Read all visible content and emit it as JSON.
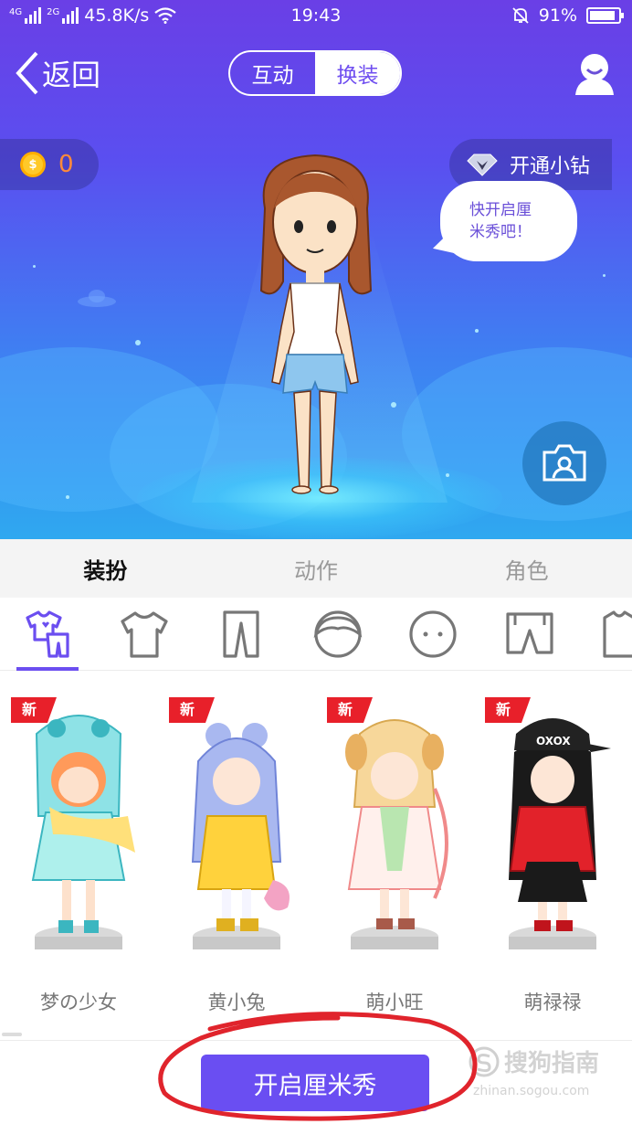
{
  "status_bar": {
    "sig1_tag": "4G",
    "sig2_tag": "2G",
    "speed": "45.8K/s",
    "time": "19:43",
    "battery": "91%",
    "battery_level": 0.91
  },
  "nav": {
    "back_label": "返回",
    "seg_interact": "互动",
    "seg_dressup": "换装"
  },
  "wallet": {
    "coins": "0"
  },
  "vip": {
    "label": "开通小钻"
  },
  "bubble": {
    "line1": "快开启厘",
    "line2": "米秀吧！"
  },
  "tabs": [
    {
      "label": "装扮",
      "active": true
    },
    {
      "label": "动作",
      "active": false
    },
    {
      "label": "角色",
      "active": false
    }
  ],
  "categories": [
    "outfit-set-icon",
    "top-icon",
    "pants-icon",
    "hair-icon",
    "face-icon",
    "shorts-icon",
    "accessory-icon"
  ],
  "items": [
    {
      "badge": "新",
      "label": "梦の少女"
    },
    {
      "badge": "新",
      "label": "黄小兔"
    },
    {
      "badge": "新",
      "label": "萌小旺"
    },
    {
      "badge": "新",
      "label": "萌禄禄"
    }
  ],
  "bottom": {
    "open_label": "开启厘米秀"
  },
  "watermark": {
    "text": "搜狗指南",
    "sub": "zhinan.sogou.com"
  },
  "colors": {
    "accent": "#6a4ef2",
    "badge": "#e8202a",
    "annotation": "#e0242c"
  }
}
